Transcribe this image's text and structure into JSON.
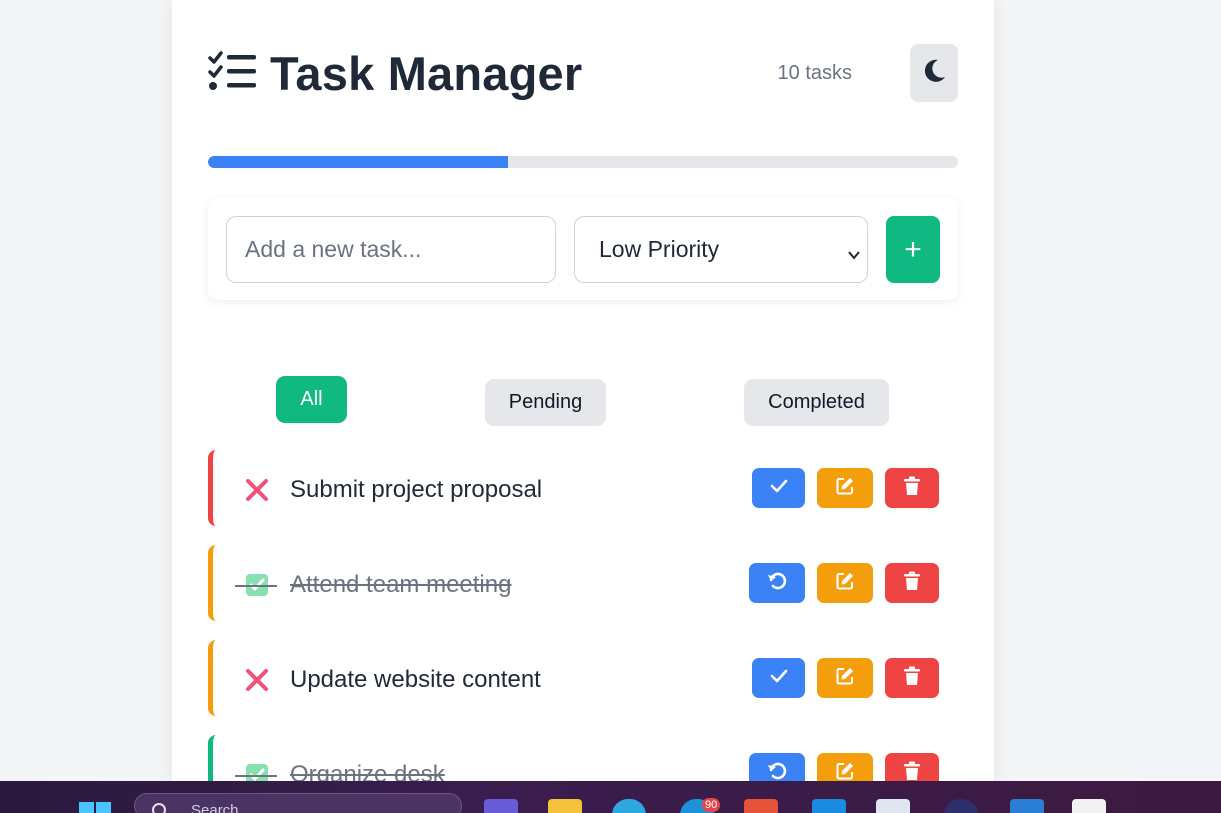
{
  "app": {
    "title": "Task Manager",
    "task_count": "10 tasks",
    "theme_toggle_icon": "moon-icon",
    "progress_fraction": 0.4
  },
  "add_form": {
    "placeholder": "Add a new task...",
    "priority_selected": "Low Priority",
    "add_label": "+"
  },
  "filters": [
    {
      "label": "All",
      "active": true
    },
    {
      "label": "Pending",
      "active": false
    },
    {
      "label": "Completed",
      "active": false
    }
  ],
  "tasks": [
    {
      "text": "Submit project proposal",
      "completed": false,
      "priority_color": "#ef4444"
    },
    {
      "text": "Attend team meeting",
      "completed": true,
      "priority_color": "#f59e0b"
    },
    {
      "text": "Update website content",
      "completed": false,
      "priority_color": "#f59e0b"
    },
    {
      "text": "Organize desk",
      "completed": true,
      "priority_color": "#10b981"
    }
  ],
  "taskbar": {
    "search_placeholder": "Search",
    "notification_badge": "90"
  },
  "colors": {
    "primary": "#3b82f6",
    "accent_green": "#10b981",
    "warning": "#f59e0b",
    "danger": "#ef4444"
  }
}
